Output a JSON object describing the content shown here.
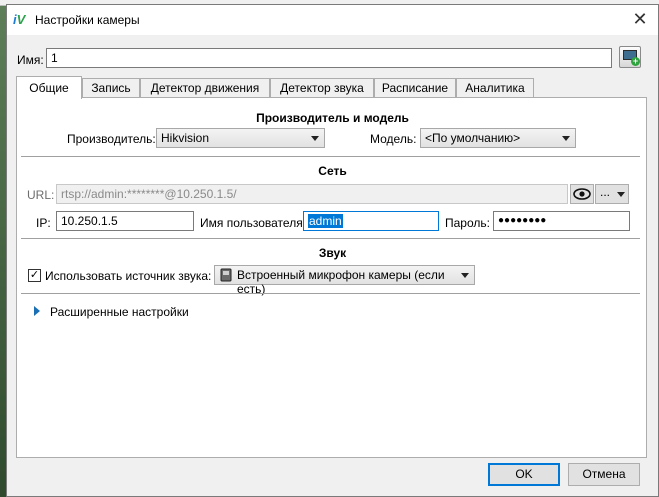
{
  "window": {
    "title": "Настройки камеры",
    "close_glyph": "✕"
  },
  "name": {
    "label": "Имя:",
    "value": "1"
  },
  "tabs": [
    {
      "label": "Общие",
      "active": true
    },
    {
      "label": "Запись"
    },
    {
      "label": "Детектор движения"
    },
    {
      "label": "Детектор звука"
    },
    {
      "label": "Расписание"
    },
    {
      "label": "Аналитика"
    }
  ],
  "manufacturer_section": {
    "title": "Производитель и модель",
    "manufacturer_label": "Производитель:",
    "manufacturer_value": "Hikvision",
    "model_label": "Модель:",
    "model_value": "<По умолчанию>"
  },
  "network_section": {
    "title": "Сеть",
    "url_label": "URL:",
    "url_value": "rtsp://admin:********@10.250.1.5/",
    "more_label": "...",
    "ip_label": "IP:",
    "ip_value": "10.250.1.5",
    "user_label": "Имя пользователя:",
    "user_value": "admin",
    "password_label": "Пароль:",
    "password_value": "●●●●●●●●"
  },
  "sound_section": {
    "title": "Звук",
    "use_source_label": "Использовать источник звука:",
    "use_source_checked": true,
    "source_value": "Встроенный микрофон камеры (если есть)"
  },
  "advanced": {
    "label": "Расширенные настройки"
  },
  "footer": {
    "ok_label": "OK",
    "cancel_label": "Отмена"
  },
  "colors": {
    "accent": "#0078d7",
    "expander": "#1b6fb5"
  }
}
